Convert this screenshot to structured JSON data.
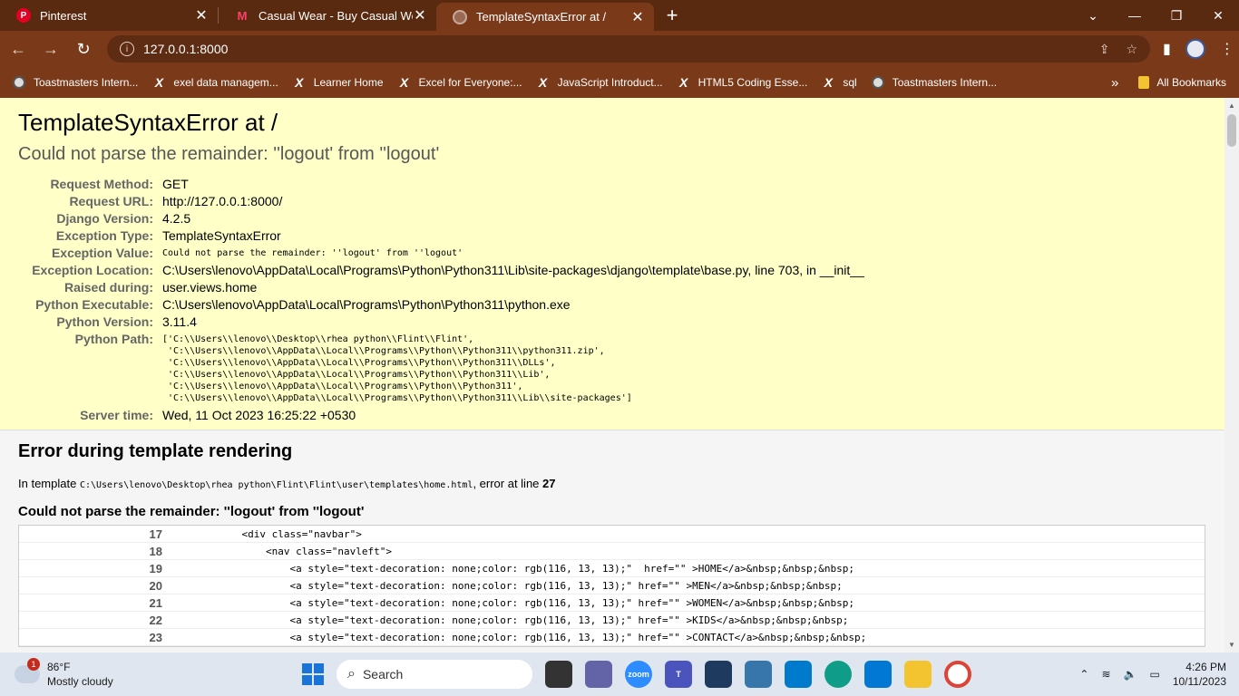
{
  "browser": {
    "tabs": [
      {
        "title": "Pinterest",
        "close": "✕",
        "active": false
      },
      {
        "title": "Casual Wear - Buy Casual Wear C",
        "close": "✕",
        "active": false
      },
      {
        "title": "TemplateSyntaxError at /",
        "close": "✕",
        "active": true
      }
    ],
    "new_tab": "+",
    "window_controls": [
      "⌄",
      "—",
      "❐",
      "✕"
    ],
    "url": "127.0.0.1:8000",
    "bookmarks": [
      {
        "label": "Toastmasters Intern...",
        "icon": "globe-icon"
      },
      {
        "label": "exel data managem...",
        "icon": "x-icon"
      },
      {
        "label": "Learner Home",
        "icon": "x-icon"
      },
      {
        "label": "Excel for Everyone:...",
        "icon": "x-icon"
      },
      {
        "label": "JavaScript Introduct...",
        "icon": "x-icon"
      },
      {
        "label": "HTML5 Coding Esse...",
        "icon": "x-icon"
      },
      {
        "label": "sql",
        "icon": "x-icon"
      },
      {
        "label": "Toastmasters Intern...",
        "icon": "globe-icon"
      }
    ],
    "bookmarks_more": "»",
    "all_bookmarks": "All Bookmarks"
  },
  "error": {
    "title": "TemplateSyntaxError at /",
    "subtitle": "Could not parse the remainder: ''logout' from ''logout'",
    "meta": [
      {
        "key": "Request Method:",
        "value": "GET"
      },
      {
        "key": "Request URL:",
        "value": "http://127.0.0.1:8000/"
      },
      {
        "key": "Django Version:",
        "value": "4.2.5"
      },
      {
        "key": "Exception Type:",
        "value": "TemplateSyntaxError"
      },
      {
        "key": "Exception Value:",
        "value": "Could not parse the remainder: ''logout' from ''logout'"
      },
      {
        "key": "Exception Location:",
        "value": "C:\\Users\\lenovo\\AppData\\Local\\Programs\\Python\\Python311\\Lib\\site-packages\\django\\template\\base.py, line 703, in __init__"
      },
      {
        "key": "Raised during:",
        "value": "user.views.home"
      },
      {
        "key": "Python Executable:",
        "value": "C:\\Users\\lenovo\\AppData\\Local\\Programs\\Python\\Python311\\python.exe"
      },
      {
        "key": "Python Version:",
        "value": "3.11.4"
      },
      {
        "key": "Python Path:",
        "value": "['C:\\\\Users\\\\lenovo\\\\Desktop\\\\rhea python\\\\Flint\\\\Flint',\n 'C:\\\\Users\\\\lenovo\\\\AppData\\\\Local\\\\Programs\\\\Python\\\\Python311\\\\python311.zip',\n 'C:\\\\Users\\\\lenovo\\\\AppData\\\\Local\\\\Programs\\\\Python\\\\Python311\\\\DLLs',\n 'C:\\\\Users\\\\lenovo\\\\AppData\\\\Local\\\\Programs\\\\Python\\\\Python311\\\\Lib',\n 'C:\\\\Users\\\\lenovo\\\\AppData\\\\Local\\\\Programs\\\\Python\\\\Python311',\n 'C:\\\\Users\\\\lenovo\\\\AppData\\\\Local\\\\Programs\\\\Python\\\\Python311\\\\Lib\\\\site-packages']"
      },
      {
        "key": "Server time:",
        "value": "Wed, 11 Oct 2023 16:25:22 +0530"
      }
    ]
  },
  "template": {
    "heading": "Error during template rendering",
    "in_template_prefix": "In template",
    "path": "C:\\Users\\lenovo\\Desktop\\rhea python\\Flint\\Flint\\user\\templates\\home.html",
    "error_at_line": ", error at line",
    "line": "27",
    "message": "Could not parse the remainder: ''logout' from ''logout'",
    "source_lines": [
      {
        "num": "17",
        "code": "            <div class=\"navbar\">"
      },
      {
        "num": "18",
        "code": "                <nav class=\"navleft\">"
      },
      {
        "num": "19",
        "code": "                    <a style=\"text-decoration: none;color: rgb(116, 13, 13);\"  href=\"\" >HOME</a>&nbsp;&nbsp;&nbsp;"
      },
      {
        "num": "20",
        "code": "                    <a style=\"text-decoration: none;color: rgb(116, 13, 13);\" href=\"\" >MEN</a>&nbsp;&nbsp;&nbsp;"
      },
      {
        "num": "21",
        "code": "                    <a style=\"text-decoration: none;color: rgb(116, 13, 13);\" href=\"\" >WOMEN</a>&nbsp;&nbsp;&nbsp;"
      },
      {
        "num": "22",
        "code": "                    <a style=\"text-decoration: none;color: rgb(116, 13, 13);\" href=\"\" >KIDS</a>&nbsp;&nbsp;&nbsp;"
      },
      {
        "num": "23",
        "code": "                    <a style=\"text-decoration: none;color: rgb(116, 13, 13);\" href=\"\" >CONTACT</a>&nbsp;&nbsp;&nbsp;"
      }
    ]
  },
  "taskbar": {
    "weather_badge": "1",
    "temperature": "86°F",
    "condition": "Mostly cloudy",
    "search_placeholder": "Search",
    "time": "4:26 PM",
    "date": "10/11/2023"
  },
  "colors": {
    "tab_strip": "#5a2a10",
    "toolbar": "#7a3a1a",
    "summary_bg": "#ffffc8"
  }
}
